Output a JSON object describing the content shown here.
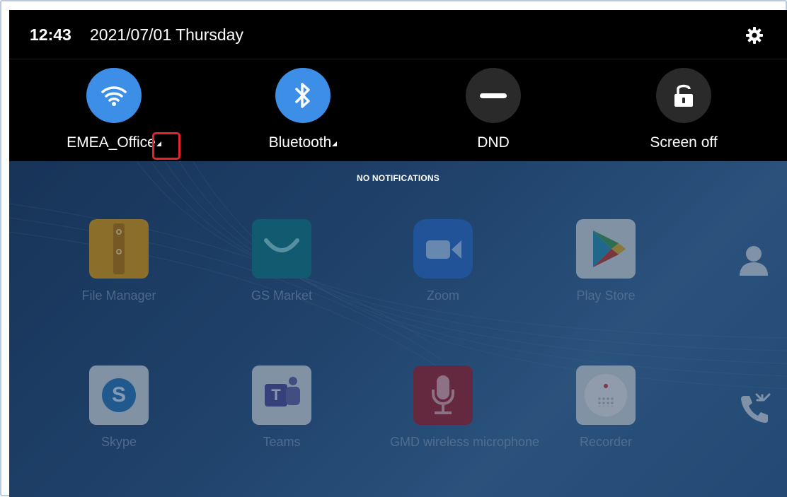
{
  "status_bar": {
    "time": "12:43",
    "date": "2021/07/01 Thursday",
    "settings_icon": "gear-icon"
  },
  "quick_settings": [
    {
      "label": "EMEA_Office",
      "icon": "wifi-icon",
      "active": true,
      "has_dropdown": true
    },
    {
      "label": "Bluetooth",
      "icon": "bluetooth-icon",
      "active": true,
      "has_dropdown": true
    },
    {
      "label": "DND",
      "icon": "dnd-minus-icon",
      "active": false,
      "has_dropdown": false
    },
    {
      "label": "Screen off",
      "icon": "lock-icon",
      "active": false,
      "has_dropdown": false
    }
  ],
  "notifications": {
    "empty_text": "NO NOTIFICATIONS"
  },
  "apps": [
    {
      "label": "File Manager",
      "icon": "file-manager-icon"
    },
    {
      "label": "GS Market",
      "icon": "gs-market-icon"
    },
    {
      "label": "Zoom",
      "icon": "zoom-icon"
    },
    {
      "label": "Play Store",
      "icon": "play-store-icon"
    },
    {
      "label": "Skype",
      "icon": "skype-icon"
    },
    {
      "label": "Teams",
      "icon": "teams-icon"
    },
    {
      "label": "GMD wireless microphone",
      "icon": "microphone-icon"
    },
    {
      "label": "Recorder",
      "icon": "recorder-icon"
    }
  ],
  "side_rail": [
    {
      "icon": "contacts-icon"
    },
    {
      "icon": "call-log-icon"
    }
  ],
  "colors": {
    "panel_bg": "#000000",
    "tile_active": "#3d8ee6",
    "tile_inactive": "#2a2a2a",
    "highlight": "#e8222a"
  }
}
